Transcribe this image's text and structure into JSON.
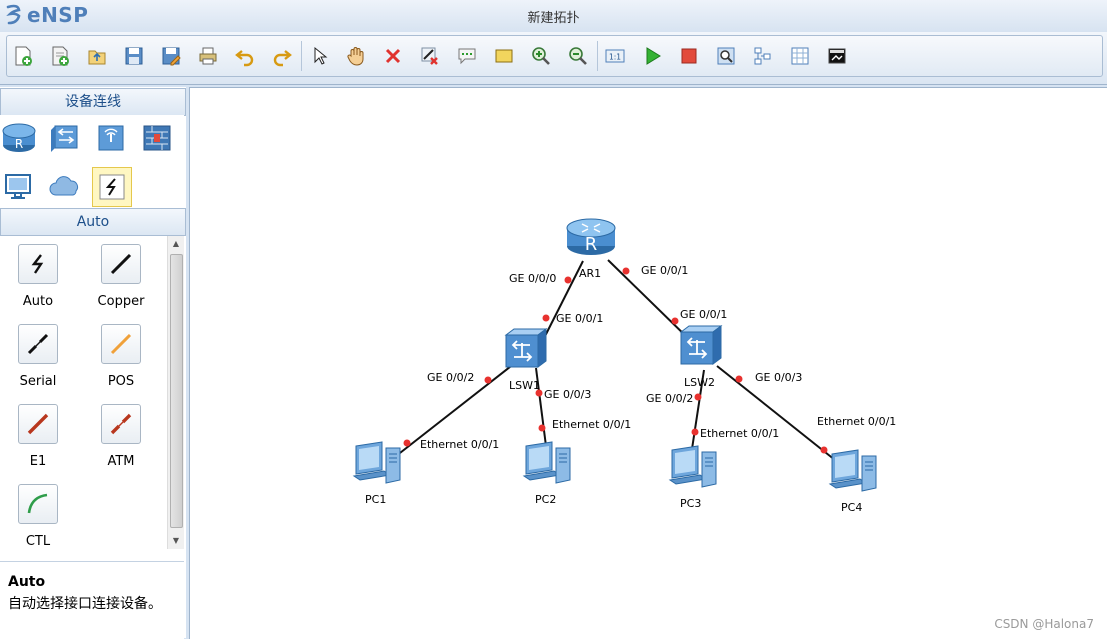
{
  "app": {
    "name": "eNSP",
    "window_title": "新建拓扑"
  },
  "toolbar": {
    "buttons": [
      "new-topology-icon",
      "new-from-example-icon",
      "open-icon",
      "save-icon",
      "save-as-icon",
      "print-icon",
      "undo-icon",
      "redo-icon",
      "select-pointer-icon",
      "pan-hand-icon",
      "delete-icon",
      "delete-link-icon",
      "add-text-icon",
      "add-shape-icon",
      "zoom-in-icon",
      "zoom-out-icon",
      "interface-number-icon",
      "start-device-icon",
      "stop-device-icon",
      "capture-data-icon",
      "show-grid-icon",
      "topology-manager-icon",
      "console-icon"
    ]
  },
  "left_panel": {
    "devices_header": "设备连线",
    "device_categories": [
      "router-icon",
      "switch-icon",
      "wlan-icon",
      "firewall-icon",
      "terminal-pc-icon",
      "cloud-icon",
      "connection-icon"
    ],
    "connections_header": "Auto",
    "connection_types": [
      {
        "label": "Auto"
      },
      {
        "label": "Copper"
      },
      {
        "label": "Serial"
      },
      {
        "label": "POS"
      },
      {
        "label": "E1"
      },
      {
        "label": "ATM"
      },
      {
        "label": "CTL"
      }
    ],
    "description": {
      "title": "Auto",
      "text": "自动选择接口连接设备。"
    }
  },
  "topology": {
    "devices": [
      {
        "id": "AR1",
        "type": "router"
      },
      {
        "id": "LSW1",
        "type": "switch"
      },
      {
        "id": "LSW2",
        "type": "switch"
      },
      {
        "id": "PC1",
        "type": "pc"
      },
      {
        "id": "PC2",
        "type": "pc"
      },
      {
        "id": "PC3",
        "type": "pc"
      },
      {
        "id": "PC4",
        "type": "pc"
      }
    ],
    "links": [
      {
        "from": "AR1",
        "from_port": "GE 0/0/0",
        "to": "LSW1",
        "to_port": "GE 0/0/1"
      },
      {
        "from": "AR1",
        "from_port": "GE 0/0/1",
        "to": "LSW2",
        "to_port": "GE 0/0/1"
      },
      {
        "from": "LSW1",
        "from_port": "GE 0/0/2",
        "to": "PC1",
        "to_port": "Ethernet 0/0/1"
      },
      {
        "from": "LSW1",
        "from_port": "GE 0/0/3",
        "to": "PC2",
        "to_port": "Ethernet 0/0/1"
      },
      {
        "from": "LSW2",
        "from_port": "GE 0/0/2",
        "to": "PC3",
        "to_port": "Ethernet 0/0/1"
      },
      {
        "from": "LSW2",
        "from_port": "GE 0/0/3",
        "to": "PC4",
        "to_port": "Ethernet 0/0/1"
      }
    ]
  },
  "watermark": "CSDN @Halona7",
  "colors": {
    "port_dot": "#e8322f",
    "link": "#111111",
    "accent": "#4f7fb9"
  }
}
